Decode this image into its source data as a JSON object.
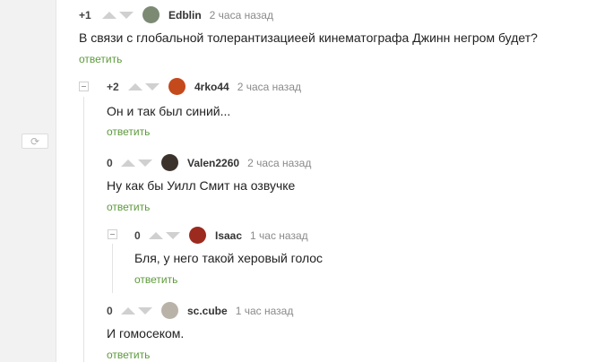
{
  "refresh": {
    "icon": "refresh-icon",
    "glyph": "⟳"
  },
  "reply_label": "ответить",
  "colors": {
    "reply": "#5c9a3b",
    "vote_arrow": "#d0d0d0",
    "side_panel": "#f2f2f2"
  },
  "comments": [
    {
      "rating": "+1",
      "author": "Edblin",
      "time": "2 часа назад",
      "text": "В связи с глобальной толерантизациеей кинематографа Джинн негром будет?",
      "avatar_color": "#7c8a74"
    },
    {
      "rating": "+2",
      "author": "4rko44",
      "time": "2 часа назад",
      "text": "Он и так был синий...",
      "avatar_color": "#c4491b"
    },
    {
      "rating": "0",
      "author": "Valen2260",
      "time": "2 часа назад",
      "text": "Ну как бы Уилл Смит на озвучке",
      "avatar_color": "#3b332b"
    },
    {
      "rating": "0",
      "author": "Isaac",
      "time": "1 час назад",
      "text": "Бля, у него такой херовый голос",
      "avatar_color": "#9c2a1e"
    },
    {
      "rating": "0",
      "author": "sc.cube",
      "time": "1 час назад",
      "text": "И гомосеком.",
      "avatar_color": "#b9b2a8"
    }
  ]
}
